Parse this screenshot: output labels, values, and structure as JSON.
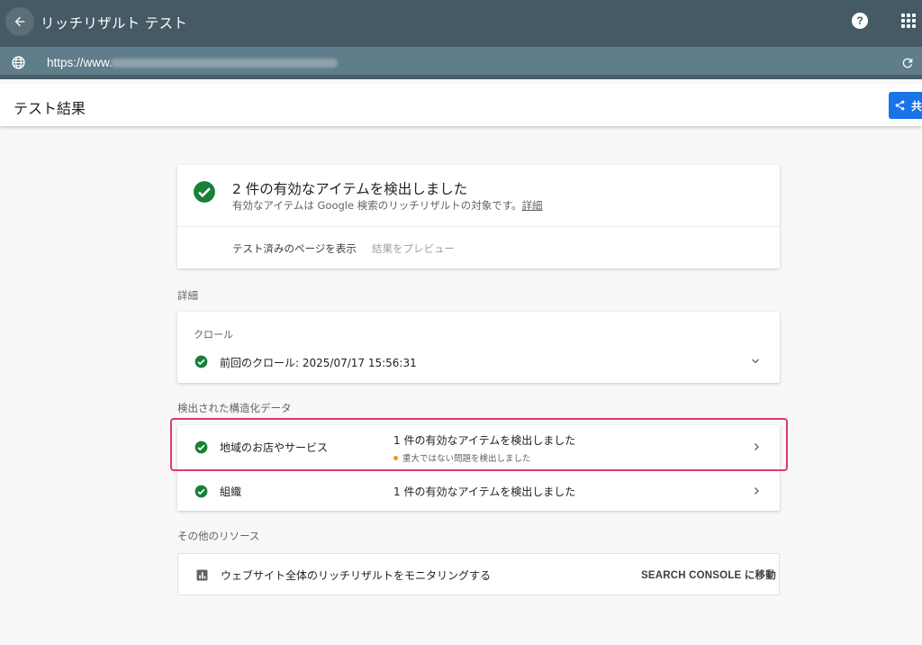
{
  "header": {
    "title": "リッチリザルト テスト",
    "help_glyph": "?"
  },
  "url_bar": {
    "url_visible": "https://www."
  },
  "result_bar": {
    "title": "テスト結果",
    "share_label": "共"
  },
  "summary": {
    "headline": "2 件の有効なアイテムを検出しました",
    "subline": "有効なアイテムは Google 検索のリッチリザルトの対象です。",
    "details_link": "詳細",
    "actions": [
      "テスト済みのページを表示",
      "結果をプレビュー"
    ]
  },
  "sections": {
    "details": "詳細",
    "structured": "検出された構造化データ",
    "other": "その他のリソース"
  },
  "crawl": {
    "label": "クロール",
    "text": "前回のクロール: 2025/07/17 15:56:31"
  },
  "items": [
    {
      "name": "地域のお店やサービス",
      "status": "1 件の有効なアイテムを検出しました",
      "sub": "重大ではない問題を検出しました",
      "highlighted": true
    },
    {
      "name": "組織",
      "status": "1 件の有効なアイテムを検出しました"
    }
  ],
  "resource": {
    "text": "ウェブサイト全体のリッチリザルトをモニタリングする",
    "cta": "SEARCH CONSOLE に移動"
  },
  "colors": {
    "topbar": "#455a64",
    "urlbar": "#607d8b",
    "check_green": "#188038",
    "highlight": "#e0386f",
    "share_blue": "#1a73e8",
    "warning_dot": "#f29900"
  },
  "icons": [
    "back-arrow-icon",
    "help-icon",
    "apps-grid-icon",
    "globe-icon",
    "reload-icon",
    "share-icon",
    "check-circle-icon",
    "chevron-down-icon",
    "chevron-right-icon",
    "bar-chart-icon"
  ]
}
